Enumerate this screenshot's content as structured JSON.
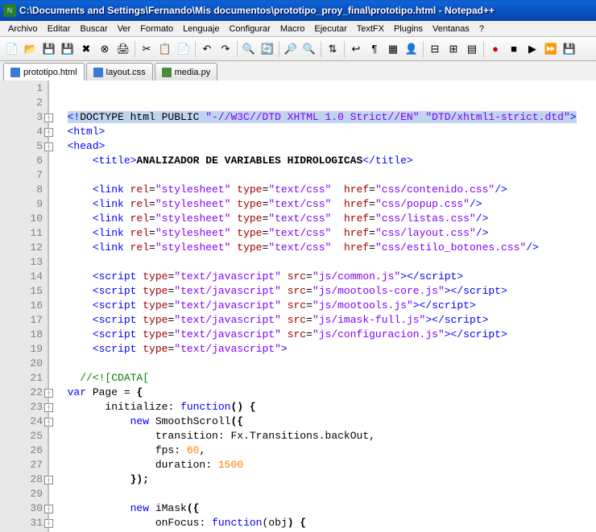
{
  "window": {
    "title": "C:\\Documents and Settings\\Fernando\\Mis documentos\\prototipo_proy_final\\prototipo.html - Notepad++"
  },
  "menu": {
    "items": [
      "Archivo",
      "Editar",
      "Buscar",
      "Ver",
      "Formato",
      "Lenguaje",
      "Configurar",
      "Macro",
      "Ejecutar",
      "TextFX",
      "Plugins",
      "Ventanas",
      "?"
    ]
  },
  "tabs": [
    {
      "label": "prototipo.html",
      "active": true,
      "icon": "html"
    },
    {
      "label": "layout.css",
      "active": false,
      "icon": "css"
    },
    {
      "label": "media.py",
      "active": false,
      "icon": "py"
    }
  ],
  "code": {
    "lines": [
      {
        "n": 1,
        "segs": []
      },
      {
        "n": 2,
        "segs": []
      },
      {
        "n": 3,
        "fold": "-",
        "segs": [
          {
            "t": "  ",
            "c": ""
          },
          {
            "t": "<!",
            "c": "t-blue sel"
          },
          {
            "t": "DOCTYPE html PUBLIC ",
            "c": "sel"
          },
          {
            "t": "\"-//W3C//DTD XHTML 1.0 Strict//EN\"",
            "c": "t-purple sel"
          },
          {
            "t": " ",
            "c": "sel"
          },
          {
            "t": "\"DTD/xhtml1-strict.dtd\"",
            "c": "t-purple sel"
          },
          {
            "t": ">",
            "c": "t-blue sel"
          }
        ]
      },
      {
        "n": 4,
        "fold": "-",
        "segs": [
          {
            "t": "  ",
            "c": ""
          },
          {
            "t": "<html>",
            "c": "t-blue"
          }
        ]
      },
      {
        "n": 5,
        "fold": "-",
        "segs": [
          {
            "t": "  ",
            "c": ""
          },
          {
            "t": "<head>",
            "c": "t-blue"
          }
        ]
      },
      {
        "n": 6,
        "segs": [
          {
            "t": "      ",
            "c": ""
          },
          {
            "t": "<title>",
            "c": "t-blue"
          },
          {
            "t": "ANALIZADOR DE VARIABLES HIDROLOGICAS",
            "c": "t-bold"
          },
          {
            "t": "</title>",
            "c": "t-blue"
          }
        ]
      },
      {
        "n": 7,
        "segs": []
      },
      {
        "n": 8,
        "segs": [
          {
            "t": "      ",
            "c": ""
          },
          {
            "t": "<link ",
            "c": "t-blue"
          },
          {
            "t": "rel",
            "c": "t-red"
          },
          {
            "t": "=",
            "c": ""
          },
          {
            "t": "\"stylesheet\"",
            "c": "t-purple"
          },
          {
            "t": " ",
            "c": ""
          },
          {
            "t": "type",
            "c": "t-red"
          },
          {
            "t": "=",
            "c": ""
          },
          {
            "t": "\"text/css\"",
            "c": "t-purple"
          },
          {
            "t": "  ",
            "c": ""
          },
          {
            "t": "href",
            "c": "t-red"
          },
          {
            "t": "=",
            "c": ""
          },
          {
            "t": "\"css/contenido.css\"",
            "c": "t-purple"
          },
          {
            "t": "/>",
            "c": "t-blue"
          }
        ]
      },
      {
        "n": 9,
        "segs": [
          {
            "t": "      ",
            "c": ""
          },
          {
            "t": "<link ",
            "c": "t-blue"
          },
          {
            "t": "rel",
            "c": "t-red"
          },
          {
            "t": "=",
            "c": ""
          },
          {
            "t": "\"stylesheet\"",
            "c": "t-purple"
          },
          {
            "t": " ",
            "c": ""
          },
          {
            "t": "type",
            "c": "t-red"
          },
          {
            "t": "=",
            "c": ""
          },
          {
            "t": "\"text/css\"",
            "c": "t-purple"
          },
          {
            "t": "  ",
            "c": ""
          },
          {
            "t": "href",
            "c": "t-red"
          },
          {
            "t": "=",
            "c": ""
          },
          {
            "t": "\"css/popup.css\"",
            "c": "t-purple"
          },
          {
            "t": "/>",
            "c": "t-blue"
          }
        ]
      },
      {
        "n": 10,
        "segs": [
          {
            "t": "      ",
            "c": ""
          },
          {
            "t": "<link ",
            "c": "t-blue"
          },
          {
            "t": "rel",
            "c": "t-red"
          },
          {
            "t": "=",
            "c": ""
          },
          {
            "t": "\"stylesheet\"",
            "c": "t-purple"
          },
          {
            "t": " ",
            "c": ""
          },
          {
            "t": "type",
            "c": "t-red"
          },
          {
            "t": "=",
            "c": ""
          },
          {
            "t": "\"text/css\"",
            "c": "t-purple"
          },
          {
            "t": "  ",
            "c": ""
          },
          {
            "t": "href",
            "c": "t-red"
          },
          {
            "t": "=",
            "c": ""
          },
          {
            "t": "\"css/listas.css\"",
            "c": "t-purple"
          },
          {
            "t": "/>",
            "c": "t-blue"
          }
        ]
      },
      {
        "n": 11,
        "segs": [
          {
            "t": "      ",
            "c": ""
          },
          {
            "t": "<link ",
            "c": "t-blue"
          },
          {
            "t": "rel",
            "c": "t-red"
          },
          {
            "t": "=",
            "c": ""
          },
          {
            "t": "\"stylesheet\"",
            "c": "t-purple"
          },
          {
            "t": " ",
            "c": ""
          },
          {
            "t": "type",
            "c": "t-red"
          },
          {
            "t": "=",
            "c": ""
          },
          {
            "t": "\"text/css\"",
            "c": "t-purple"
          },
          {
            "t": "  ",
            "c": ""
          },
          {
            "t": "href",
            "c": "t-red"
          },
          {
            "t": "=",
            "c": ""
          },
          {
            "t": "\"css/layout.css\"",
            "c": "t-purple"
          },
          {
            "t": "/>",
            "c": "t-blue"
          }
        ]
      },
      {
        "n": 12,
        "segs": [
          {
            "t": "      ",
            "c": ""
          },
          {
            "t": "<link ",
            "c": "t-blue"
          },
          {
            "t": "rel",
            "c": "t-red"
          },
          {
            "t": "=",
            "c": ""
          },
          {
            "t": "\"stylesheet\"",
            "c": "t-purple"
          },
          {
            "t": " ",
            "c": ""
          },
          {
            "t": "type",
            "c": "t-red"
          },
          {
            "t": "=",
            "c": ""
          },
          {
            "t": "\"text/css\"",
            "c": "t-purple"
          },
          {
            "t": "  ",
            "c": ""
          },
          {
            "t": "href",
            "c": "t-red"
          },
          {
            "t": "=",
            "c": ""
          },
          {
            "t": "\"css/estilo_botones.css\"",
            "c": "t-purple"
          },
          {
            "t": "/>",
            "c": "t-blue"
          }
        ]
      },
      {
        "n": 13,
        "segs": []
      },
      {
        "n": 14,
        "segs": [
          {
            "t": "      ",
            "c": ""
          },
          {
            "t": "<script ",
            "c": "t-blue"
          },
          {
            "t": "type",
            "c": "t-red"
          },
          {
            "t": "=",
            "c": ""
          },
          {
            "t": "\"text/javascript\"",
            "c": "t-purple"
          },
          {
            "t": " ",
            "c": ""
          },
          {
            "t": "src",
            "c": "t-red"
          },
          {
            "t": "=",
            "c": ""
          },
          {
            "t": "\"js/common.js\"",
            "c": "t-purple"
          },
          {
            "t": "></",
            "c": "t-blue"
          },
          {
            "t": "script",
            "c": "t-blue"
          },
          {
            "t": ">",
            "c": "t-blue"
          }
        ]
      },
      {
        "n": 15,
        "segs": [
          {
            "t": "      ",
            "c": ""
          },
          {
            "t": "<script ",
            "c": "t-blue"
          },
          {
            "t": "type",
            "c": "t-red"
          },
          {
            "t": "=",
            "c": ""
          },
          {
            "t": "\"text/javascript\"",
            "c": "t-purple"
          },
          {
            "t": " ",
            "c": ""
          },
          {
            "t": "src",
            "c": "t-red"
          },
          {
            "t": "=",
            "c": ""
          },
          {
            "t": "\"js/mootools-core.js\"",
            "c": "t-purple"
          },
          {
            "t": "></",
            "c": "t-blue"
          },
          {
            "t": "script",
            "c": "t-blue"
          },
          {
            "t": ">",
            "c": "t-blue"
          }
        ]
      },
      {
        "n": 16,
        "segs": [
          {
            "t": "      ",
            "c": ""
          },
          {
            "t": "<script ",
            "c": "t-blue"
          },
          {
            "t": "type",
            "c": "t-red"
          },
          {
            "t": "=",
            "c": ""
          },
          {
            "t": "\"text/javascript\"",
            "c": "t-purple"
          },
          {
            "t": " ",
            "c": ""
          },
          {
            "t": "src",
            "c": "t-red"
          },
          {
            "t": "=",
            "c": ""
          },
          {
            "t": "\"js/mootools.js\"",
            "c": "t-purple"
          },
          {
            "t": "></",
            "c": "t-blue"
          },
          {
            "t": "script",
            "c": "t-blue"
          },
          {
            "t": ">",
            "c": "t-blue"
          }
        ]
      },
      {
        "n": 17,
        "segs": [
          {
            "t": "      ",
            "c": ""
          },
          {
            "t": "<script ",
            "c": "t-blue"
          },
          {
            "t": "type",
            "c": "t-red"
          },
          {
            "t": "=",
            "c": ""
          },
          {
            "t": "\"text/javascript\"",
            "c": "t-purple"
          },
          {
            "t": " ",
            "c": ""
          },
          {
            "t": "src",
            "c": "t-red"
          },
          {
            "t": "=",
            "c": ""
          },
          {
            "t": "\"js/imask-full.js\"",
            "c": "t-purple"
          },
          {
            "t": "></",
            "c": "t-blue"
          },
          {
            "t": "script",
            "c": "t-blue"
          },
          {
            "t": ">",
            "c": "t-blue"
          }
        ]
      },
      {
        "n": 18,
        "segs": [
          {
            "t": "      ",
            "c": ""
          },
          {
            "t": "<script ",
            "c": "t-blue"
          },
          {
            "t": "type",
            "c": "t-red"
          },
          {
            "t": "=",
            "c": ""
          },
          {
            "t": "\"text/javascript\"",
            "c": "t-purple"
          },
          {
            "t": " ",
            "c": ""
          },
          {
            "t": "src",
            "c": "t-red"
          },
          {
            "t": "=",
            "c": ""
          },
          {
            "t": "\"js/configuracion.js\"",
            "c": "t-purple"
          },
          {
            "t": "></",
            "c": "t-blue"
          },
          {
            "t": "script",
            "c": "t-blue"
          },
          {
            "t": ">",
            "c": "t-blue"
          }
        ]
      },
      {
        "n": 19,
        "segs": [
          {
            "t": "      ",
            "c": ""
          },
          {
            "t": "<script ",
            "c": "t-blue"
          },
          {
            "t": "type",
            "c": "t-red"
          },
          {
            "t": "=",
            "c": ""
          },
          {
            "t": "\"text/javascript\"",
            "c": "t-purple"
          },
          {
            "t": ">",
            "c": "t-blue"
          }
        ]
      },
      {
        "n": 20,
        "segs": []
      },
      {
        "n": 21,
        "segs": [
          {
            "t": "    ",
            "c": ""
          },
          {
            "t": "//<![CDATA[",
            "c": "t-green"
          }
        ]
      },
      {
        "n": 22,
        "fold": "-",
        "segs": [
          {
            "t": "  ",
            "c": ""
          },
          {
            "t": "var",
            "c": "t-blue"
          },
          {
            "t": " Page ",
            "c": ""
          },
          {
            "t": "=",
            "c": ""
          },
          {
            "t": " ",
            "c": ""
          },
          {
            "t": "{",
            "c": "t-bold"
          }
        ]
      },
      {
        "n": 23,
        "fold": "-",
        "segs": [
          {
            "t": "        initialize",
            "c": ""
          },
          {
            "t": ":",
            "c": ""
          },
          {
            "t": " ",
            "c": ""
          },
          {
            "t": "function",
            "c": "t-blue"
          },
          {
            "t": "() {",
            "c": "t-bold"
          }
        ]
      },
      {
        "n": 24,
        "fold": "-",
        "segs": [
          {
            "t": "            ",
            "c": ""
          },
          {
            "t": "new",
            "c": "t-blue"
          },
          {
            "t": " SmoothScroll",
            "c": ""
          },
          {
            "t": "({",
            "c": "t-bold"
          }
        ]
      },
      {
        "n": 25,
        "segs": [
          {
            "t": "                transition",
            "c": ""
          },
          {
            "t": ":",
            "c": ""
          },
          {
            "t": " Fx",
            "c": ""
          },
          {
            "t": ".",
            "c": ""
          },
          {
            "t": "Transitions",
            "c": ""
          },
          {
            "t": ".",
            "c": ""
          },
          {
            "t": "backOut",
            "c": ""
          },
          {
            "t": ",",
            "c": ""
          }
        ]
      },
      {
        "n": 26,
        "segs": [
          {
            "t": "                fps",
            "c": ""
          },
          {
            "t": ":",
            "c": ""
          },
          {
            "t": " ",
            "c": ""
          },
          {
            "t": "60",
            "c": "t-num"
          },
          {
            "t": ",",
            "c": ""
          }
        ]
      },
      {
        "n": 27,
        "segs": [
          {
            "t": "                duration",
            "c": ""
          },
          {
            "t": ":",
            "c": ""
          },
          {
            "t": " ",
            "c": ""
          },
          {
            "t": "1500",
            "c": "t-num"
          }
        ]
      },
      {
        "n": 28,
        "fold": "-",
        "segs": [
          {
            "t": "            ",
            "c": ""
          },
          {
            "t": "});",
            "c": "t-bold"
          }
        ]
      },
      {
        "n": 29,
        "segs": []
      },
      {
        "n": 30,
        "fold": "-",
        "segs": [
          {
            "t": "            ",
            "c": ""
          },
          {
            "t": "new",
            "c": "t-blue"
          },
          {
            "t": " iMask",
            "c": ""
          },
          {
            "t": "({",
            "c": "t-bold"
          }
        ]
      },
      {
        "n": 31,
        "fold": "-",
        "segs": [
          {
            "t": "                onFocus",
            "c": ""
          },
          {
            "t": ":",
            "c": ""
          },
          {
            "t": " ",
            "c": ""
          },
          {
            "t": "function",
            "c": "t-blue"
          },
          {
            "t": "(",
            "c": ""
          },
          {
            "t": "obj",
            "c": ""
          },
          {
            "t": ") {",
            "c": "t-bold"
          }
        ]
      }
    ]
  }
}
